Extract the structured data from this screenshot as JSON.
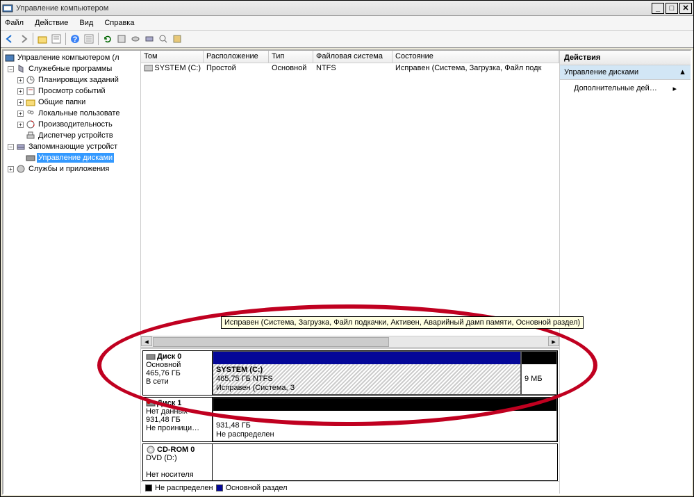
{
  "window": {
    "title": "Управление компьютером"
  },
  "menu": {
    "file": "Файл",
    "action": "Действие",
    "view": "Вид",
    "help": "Справка"
  },
  "tree": {
    "root": "Управление компьютером (л",
    "group1": "Служебные программы",
    "scheduler": "Планировщик заданий",
    "events": "Просмотр событий",
    "shared": "Общие папки",
    "localusers": "Локальные пользовате",
    "perf": "Производительность",
    "devmgr": "Диспетчер устройств",
    "group2": "Запоминающие устройст",
    "diskmgmt": "Управление дисками",
    "group3": "Службы и приложения"
  },
  "cols": {
    "c0": "Том",
    "c1": "Расположение",
    "c2": "Тип",
    "c3": "Файловая система",
    "c4": "Состояние"
  },
  "vol": {
    "name": "SYSTEM (C:)",
    "layout": "Простой",
    "type": "Основной",
    "fs": "NTFS",
    "status": "Исправен (Система, Загрузка, Файл подк"
  },
  "disk0": {
    "name": "Диск 0",
    "type": "Основной",
    "size": "465,76 ГБ",
    "state": "В сети"
  },
  "disk0_part1": {
    "title": "SYSTEM  (C:)",
    "info": "465,75 ГБ NTFS",
    "status": "Исправен (Система, З"
  },
  "disk0_part2": {
    "size": "9 МБ"
  },
  "disk1": {
    "name": "Диск 1",
    "type": "Нет данных",
    "size": "931,48 ГБ",
    "state": "Не проиници…"
  },
  "disk1_part": {
    "size": "931,48 ГБ",
    "status": "Не распределен"
  },
  "cdrom": {
    "name": "CD-ROM 0",
    "type": "DVD (D:)",
    "state": "Нет носителя"
  },
  "legend": {
    "unalloc": "Не распределен",
    "primary": "Основной раздел"
  },
  "actions": {
    "title": "Действия",
    "disk": "Управление дисками",
    "more": "Дополнительные дей…"
  },
  "tooltip": "Исправен (Система, Загрузка, Файл подкачки, Активен, Аварийный дамп памяти, Основной раздел)"
}
